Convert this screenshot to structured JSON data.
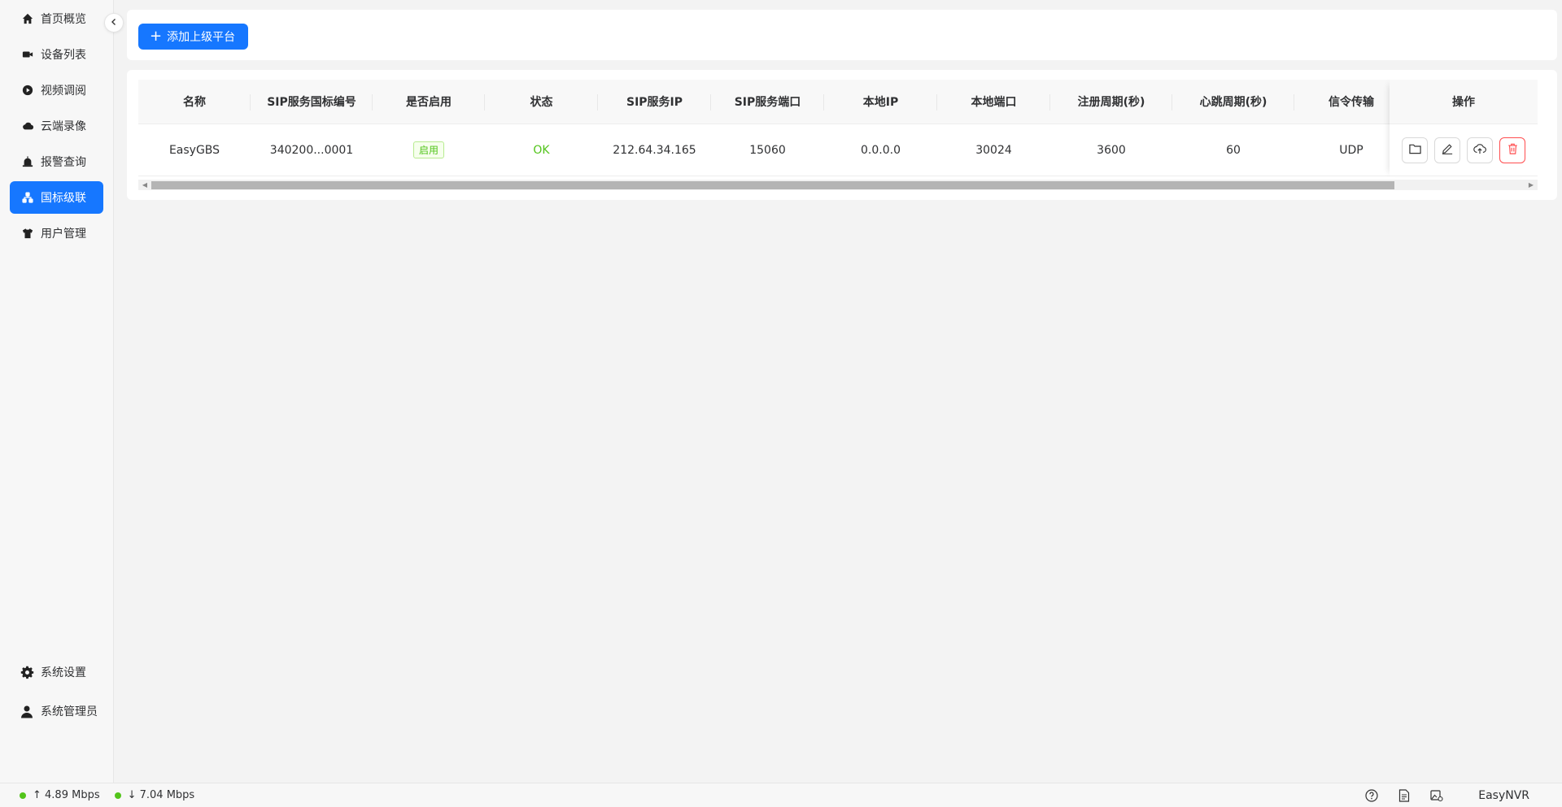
{
  "sidebar": {
    "items": [
      {
        "label": "首页概览",
        "icon": "home-icon",
        "active": false
      },
      {
        "label": "设备列表",
        "icon": "camera-icon",
        "active": false
      },
      {
        "label": "视频调阅",
        "icon": "play-circle-icon",
        "active": false
      },
      {
        "label": "云端录像",
        "icon": "cloud-icon",
        "active": false
      },
      {
        "label": "报警查询",
        "icon": "alarm-icon",
        "active": false
      },
      {
        "label": "国标级联",
        "icon": "cascade-icon",
        "active": true
      },
      {
        "label": "用户管理",
        "icon": "shirt-icon",
        "active": false
      }
    ],
    "bottom": {
      "settings_label": "系统设置",
      "admin_label": "系统管理员"
    }
  },
  "toolbar": {
    "add_button_label": "添加上级平台"
  },
  "table": {
    "columns": [
      "名称",
      "SIP服务国标编号",
      "是否启用",
      "状态",
      "SIP服务IP",
      "SIP服务端口",
      "本地IP",
      "本地端口",
      "注册周期(秒)",
      "心跳周期(秒)",
      "信令传输"
    ],
    "ops_header": "操作",
    "rows": [
      {
        "name": "EasyGBS",
        "sip_id": "340200...0001",
        "enabled": "启用",
        "status": "OK",
        "sip_ip": "212.64.34.165",
        "sip_port": "15060",
        "local_ip": "0.0.0.0",
        "local_port": "30024",
        "register_period": "3600",
        "heartbeat_period": "60",
        "transport": "UDP"
      }
    ]
  },
  "statusbar": {
    "upload_speed": "↑ 4.89 Mbps",
    "download_speed": "↓ 7.04 Mbps",
    "brand": "EasyNVR"
  },
  "colors": {
    "accent": "#1677ff",
    "success": "#52c41a",
    "danger": "#ff4d4f"
  }
}
